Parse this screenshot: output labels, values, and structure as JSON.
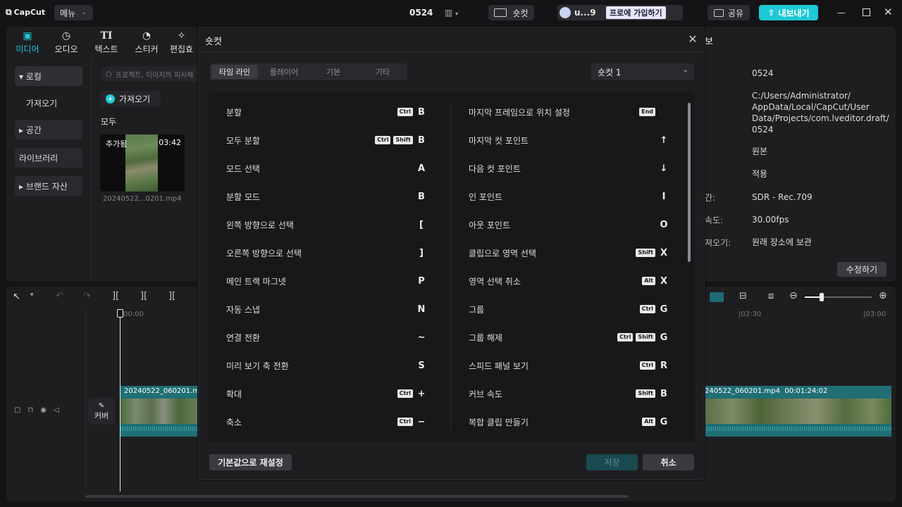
{
  "app": {
    "logo": "CapCut",
    "menu_label": "메뉴",
    "project_name": "0524",
    "shortcut_label": "숏컷",
    "user_name": "u...9",
    "pro_label": "프로에 가입하기",
    "share_label": "공유",
    "export_label": "내보내기"
  },
  "toolbar": {
    "tabs": [
      {
        "label": "미디어",
        "icon": "media-icon"
      },
      {
        "label": "오디오",
        "icon": "audio-icon"
      },
      {
        "label": "텍스트",
        "icon": "text-icon",
        "glyph": "TI"
      },
      {
        "label": "스티커",
        "icon": "sticker-icon"
      },
      {
        "label": "편집효",
        "icon": "effects-icon"
      }
    ]
  },
  "sidebar": {
    "items": [
      {
        "label": "▾ 로컬"
      },
      {
        "label": "가져오기"
      },
      {
        "label": "▸ 공간"
      },
      {
        "label": "라이브러리"
      },
      {
        "label": "▸ 브랜드 자산"
      }
    ]
  },
  "media": {
    "search_placeholder": "프로젝트, 이미지의 피사체",
    "import_label": "가져오기",
    "all_label": "모두",
    "clip": {
      "badge": "추가됨",
      "duration": "03:42",
      "name": "20240522...0201.mp4"
    }
  },
  "details": {
    "header": "보",
    "values": [
      "0524",
      "C:/Users/Administrator/\nAppData/Local/CapCut/User\nData/Projects/com.lveditor.draft/\n0524",
      "원본",
      "적용",
      "SDR - Rec.709",
      "30.00fps",
      "원래 장소에 보관"
    ],
    "labels": [
      "간:",
      "속도:",
      "져오기:"
    ],
    "edit_label": "수정하기"
  },
  "timeline": {
    "time_start": "00:00",
    "time_mid": "|02:30",
    "time_end": "|03:00",
    "clip_left_name": "20240522_060201.m",
    "clip_right_name": "240522_060201.mp4",
    "clip_right_duration": "00:01:24:02",
    "cover_label": "커버"
  },
  "modal": {
    "title": "숏컷",
    "tabs": [
      "타임 라인",
      "플레이어",
      "기본",
      "기타"
    ],
    "active_tab": 0,
    "preset": "숏컷 1",
    "left": [
      {
        "label": "분할",
        "mods": [
          "Ctrl"
        ],
        "key": "B"
      },
      {
        "label": "모두 분할",
        "mods": [
          "Ctrl",
          "Shift"
        ],
        "key": "B"
      },
      {
        "label": "모드 선택",
        "mods": [],
        "key": "A"
      },
      {
        "label": "분할 모드",
        "mods": [],
        "key": "B"
      },
      {
        "label": "왼쪽 방향으로 선택",
        "mods": [],
        "key": "["
      },
      {
        "label": "오른쪽 방향으로 선택",
        "mods": [],
        "key": "]"
      },
      {
        "label": "메인 트랙 마그넷",
        "mods": [],
        "key": "P"
      },
      {
        "label": "자동 스냅",
        "mods": [],
        "key": "N"
      },
      {
        "label": "연결 전환",
        "mods": [],
        "key": "~"
      },
      {
        "label": "미리 보기 축 전환",
        "mods": [],
        "key": "S"
      },
      {
        "label": "확대",
        "mods": [
          "Ctrl"
        ],
        "key": "+"
      },
      {
        "label": "축소",
        "mods": [
          "Ctrl"
        ],
        "key": "−"
      }
    ],
    "right": [
      {
        "label": "마지막 프레임으로 위치 설정",
        "mods": [
          "End"
        ],
        "key": ""
      },
      {
        "label": "마지막 컷 포인트",
        "mods": [],
        "key": "↑"
      },
      {
        "label": "다음 컷 포인트",
        "mods": [],
        "key": "↓"
      },
      {
        "label": "인 포인트",
        "mods": [],
        "key": "I"
      },
      {
        "label": "아웃 포인트",
        "mods": [],
        "key": "O"
      },
      {
        "label": "클립으로 영역 선택",
        "mods": [
          "Shift"
        ],
        "key": "X"
      },
      {
        "label": "영역 선택 취소",
        "mods": [
          "Alt"
        ],
        "key": "X"
      },
      {
        "label": "그룹",
        "mods": [
          "Ctrl"
        ],
        "key": "G"
      },
      {
        "label": "그룹 해제",
        "mods": [
          "Ctrl",
          "Shift"
        ],
        "key": "G"
      },
      {
        "label": "스피드 패널 보기",
        "mods": [
          "Ctrl"
        ],
        "key": "R"
      },
      {
        "label": "커브 속도",
        "mods": [
          "Shift"
        ],
        "key": "B"
      },
      {
        "label": "복합 클립 만들기",
        "mods": [
          "Alt"
        ],
        "key": "G"
      }
    ],
    "reset_label": "기본값으로 재설정",
    "save_label": "저장",
    "cancel_label": "취소"
  },
  "colors": {
    "accent": "#1ec8d6",
    "teal_clip": "#1f6f74"
  }
}
